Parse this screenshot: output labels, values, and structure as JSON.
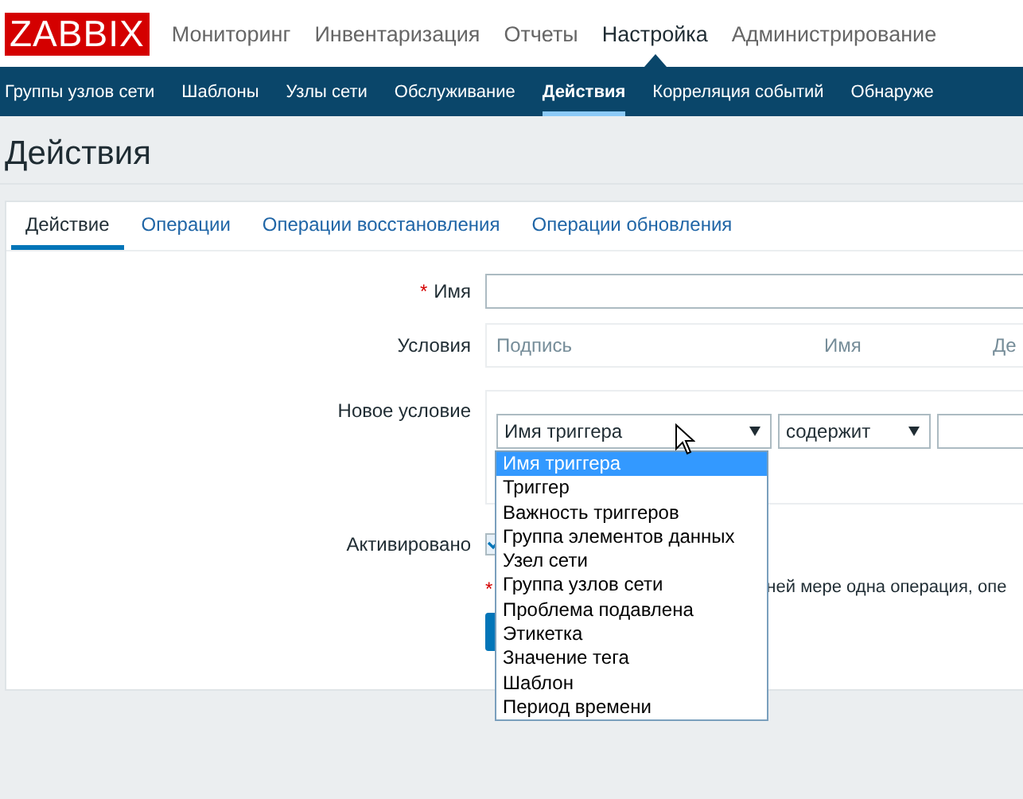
{
  "header": {
    "logo": "ZABBIX",
    "nav": [
      {
        "label": "Мониторинг",
        "selected": false
      },
      {
        "label": "Инвентаризация",
        "selected": false
      },
      {
        "label": "Отчеты",
        "selected": false
      },
      {
        "label": "Настройка",
        "selected": true
      },
      {
        "label": "Администрирование",
        "selected": false
      }
    ]
  },
  "subnav": [
    {
      "label": "Группы узлов сети",
      "selected": false
    },
    {
      "label": "Шаблоны",
      "selected": false
    },
    {
      "label": "Узлы сети",
      "selected": false
    },
    {
      "label": "Обслуживание",
      "selected": false
    },
    {
      "label": "Действия",
      "selected": true
    },
    {
      "label": "Корреляция событий",
      "selected": false
    },
    {
      "label": "Обнаруже",
      "selected": false
    }
  ],
  "page_title": "Действия",
  "tabs": [
    {
      "label": "Действие",
      "selected": true
    },
    {
      "label": "Операции",
      "selected": false
    },
    {
      "label": "Операции восстановления",
      "selected": false
    },
    {
      "label": "Операции обновления",
      "selected": false
    }
  ],
  "form": {
    "name_label": "Имя",
    "required_mark": "*",
    "conditions_label": "Условия",
    "conditions_columns": [
      "Подпись",
      "Имя",
      "Де"
    ],
    "new_condition_label": "Новое условие",
    "condition_type": "Имя триггера",
    "operator": "содержит",
    "enabled_label": "Активировано",
    "enabled": true,
    "note_mark": "*",
    "note": "ней мере одна операция, опе"
  },
  "dropdown": [
    {
      "label": "Имя триггера",
      "selected": true
    },
    {
      "label": "Триггер",
      "selected": false
    },
    {
      "label": "Важность триггеров",
      "selected": false
    },
    {
      "label": "Группа элементов данных",
      "selected": false
    },
    {
      "label": "Узел сети",
      "selected": false
    },
    {
      "label": "Группа узлов сети",
      "selected": false
    },
    {
      "label": "Проблема подавлена",
      "selected": false
    },
    {
      "label": "Этикетка",
      "selected": false
    },
    {
      "label": "Значение тега",
      "selected": false
    },
    {
      "label": "Шаблон",
      "selected": false
    },
    {
      "label": "Период времени",
      "selected": false
    }
  ]
}
